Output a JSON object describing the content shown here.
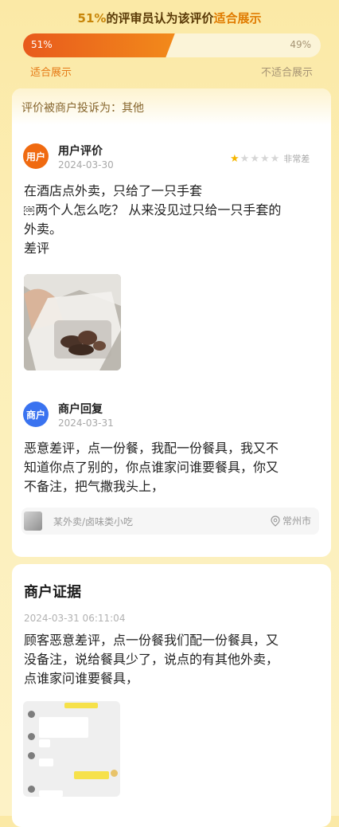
{
  "header": {
    "percent": "51%",
    "title_mid": "的评审员认为该评价",
    "title_highlight": "适合展示"
  },
  "vote_bar": {
    "left_value": "51%",
    "right_value": "49%",
    "fraction_suitable": 0.51,
    "left_label": "适合展示",
    "right_label": "不适合展示"
  },
  "complaint": {
    "header": "评价被商户投诉为：其他"
  },
  "user_review": {
    "avatar_text": "用户",
    "name": "用户评价",
    "date": "2024-03-30",
    "rating": 1,
    "rating_max": 5,
    "rating_text": "非常差",
    "lines": [
      "在酒店点外卖，只给了一只手套",
      "两个人怎么吃？ 从来没见过只给一只手套的",
      "外卖。",
      "差评"
    ],
    "glyph": "0B"
  },
  "merchant_reply": {
    "avatar_text": "商户",
    "name": "商户回复",
    "date": "2024-03-31",
    "lines": [
      "恶意差评，点一份餐，我配一份餐具，我又不",
      "知道你点了别的，你点谁家问谁要餐具，你又",
      "不备注，把气撒我头上，"
    ]
  },
  "shop": {
    "name": "某外卖/卤味类小吃",
    "location": "常州市"
  },
  "evidence": {
    "title": "商户证据",
    "time": "2024-03-31 06:11:04",
    "lines": [
      "顾客恶意差评，点一份餐我们配一份餐具，又",
      "没备注，说给餐具少了，说点的有其他外卖，",
      "点谁家问谁要餐具，"
    ]
  },
  "colors": {
    "accent_orange": "#f06a10",
    "merchant_blue": "#3a73f0",
    "star_on": "#f6b600"
  }
}
